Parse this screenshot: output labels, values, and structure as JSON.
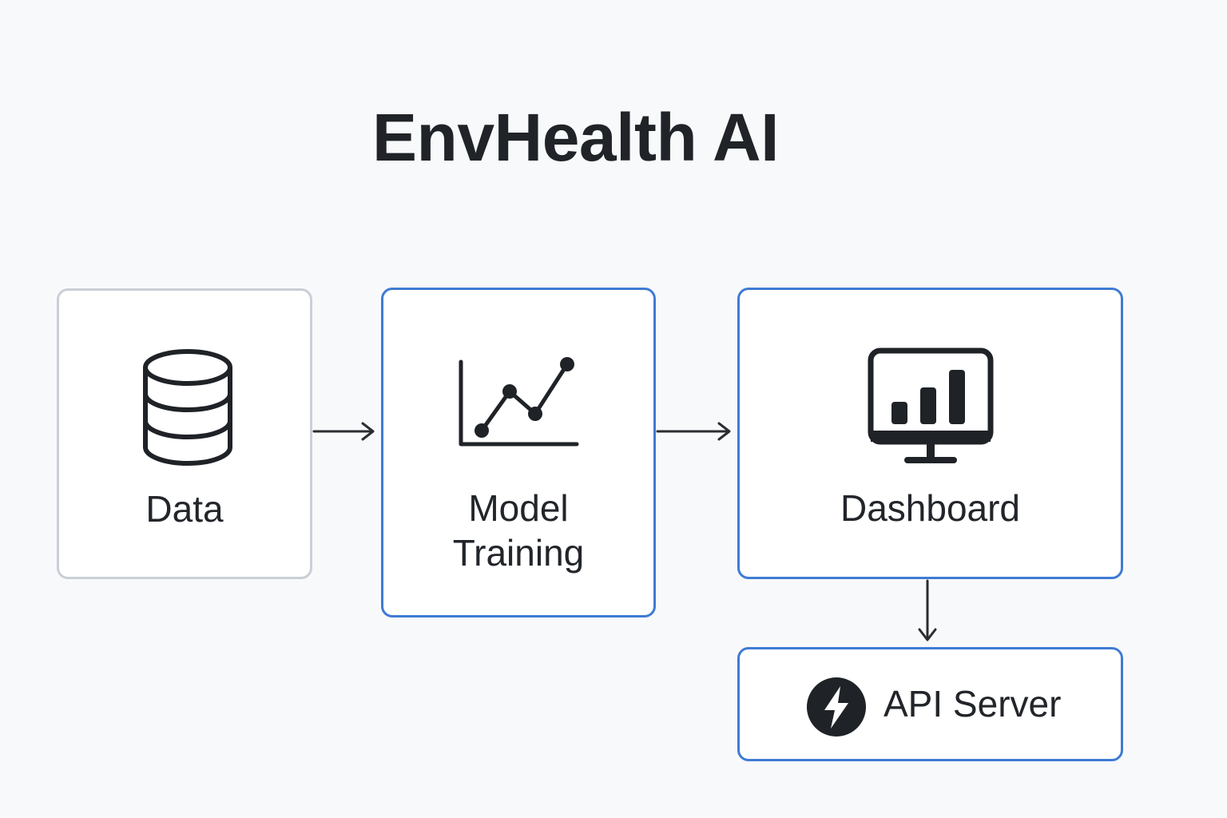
{
  "title": "EnvHealth AI",
  "colors": {
    "background": "#f8f9fb",
    "node_border_blue": "#3f7bd4",
    "node_border_gray": "#c9cfd6",
    "text": "#202327",
    "arrow": "#2a2d31"
  },
  "nodes": {
    "data": {
      "label": "Data",
      "icon": "database-icon"
    },
    "model": {
      "label": "Model\nTraining",
      "icon": "line-chart-icon"
    },
    "dashboard": {
      "label": "Dashboard",
      "icon": "monitor-bar-chart-icon"
    },
    "api": {
      "label": "API Server",
      "icon": "lightning-bolt-icon"
    }
  },
  "edges": [
    {
      "from": "Data",
      "to": "Model Training"
    },
    {
      "from": "Model Training",
      "to": "Dashboard"
    },
    {
      "from": "Dashboard",
      "to": "API Server"
    }
  ]
}
